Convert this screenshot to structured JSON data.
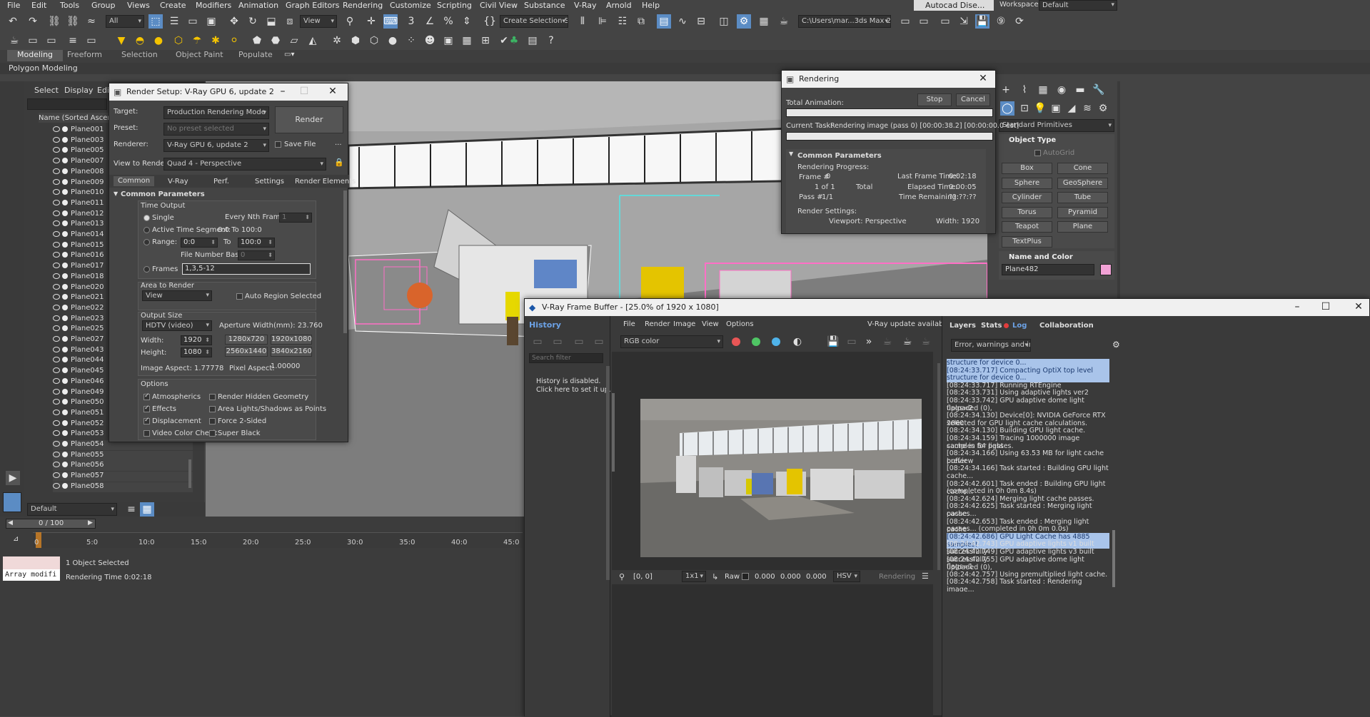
{
  "menubar": {
    "items": [
      "File",
      "Edit",
      "Tools",
      "Group",
      "Views",
      "Create",
      "Modifiers",
      "Animation",
      "Graph Editors",
      "Rendering",
      "Customize",
      "Scripting",
      "Civil View",
      "Substance",
      "V-Ray",
      "Arnold",
      "Help"
    ],
    "user": "Autocad Dise...",
    "workspaces_label": "Workspaces:",
    "workspace_value": "Default"
  },
  "toolbar": {
    "filter_value": "All",
    "view_value": "View",
    "selection_set": "Create Selection Se",
    "project_path": "C:\\Users\\mar...3ds Max 2024"
  },
  "ribbon": {
    "tabs": [
      "Modeling",
      "Freeform",
      "Selection",
      "Object Paint",
      "Populate"
    ],
    "sub": "Polygon Modeling"
  },
  "scene_explorer": {
    "tabs": [
      "Select",
      "Display",
      "Edi"
    ],
    "column": "Name (Sorted Ascending",
    "items": [
      "Plane001",
      "Plane003",
      "Plane005",
      "Plane007",
      "Plane008",
      "Plane009",
      "Plane010",
      "Plane011",
      "Plane012",
      "Plane013",
      "Plane014",
      "Plane015",
      "Plane016",
      "Plane017",
      "Plane018",
      "Plane020",
      "Plane021",
      "Plane022",
      "Plane023",
      "Plane025",
      "Plane027",
      "Plane043",
      "Plane044",
      "Plane045",
      "Plane046",
      "Plane049",
      "Plane050",
      "Plane051",
      "Plane052",
      "Plane053",
      "Plane054",
      "Plane055",
      "Plane056",
      "Plane057",
      "Plane058"
    ],
    "layer": "Default"
  },
  "render_setup": {
    "title": "Render Setup: V-Ray GPU 6, update 2",
    "target_label": "Target:",
    "target_value": "Production Rendering Mode",
    "preset_label": "Preset:",
    "preset_value": "No preset selected",
    "renderer_label": "Renderer:",
    "renderer_value": "V-Ray GPU 6, update 2",
    "save_file": "Save File",
    "view_label": "View to Render:",
    "view_value": "Quad 4 - Perspective",
    "render_button": "Render",
    "ellipsis": "...",
    "tabs": [
      "Common",
      "V-Ray",
      "Perf.",
      "Settings",
      "Render Elements"
    ],
    "rollout": "Common Parameters",
    "time_output": "Time Output",
    "single": "Single",
    "every_nth": "Every Nth Frame:",
    "every_nth_value": "1",
    "active_segment": "Active Time Segment:",
    "active_segment_value": "0:0 To 100:0",
    "range": "Range:",
    "range_from": "0:0",
    "to": "To",
    "range_to": "100:0",
    "file_number_base": "File Number Base:",
    "file_number_value": "0",
    "frames": "Frames",
    "frames_value": "1,3,5-12",
    "area_to_render": "Area to Render",
    "area_value": "View",
    "auto_region": "Auto Region Selected",
    "output_size": "Output Size",
    "output_value": "HDTV (video)",
    "aperture": "Aperture Width(mm): 23.760",
    "width_label": "Width:",
    "width_value": "1920",
    "height_label": "Height:",
    "height_value": "1080",
    "presets": [
      "1280x720",
      "1920x1080",
      "2560x1440",
      "3840x2160"
    ],
    "image_aspect": "Image Aspect: 1.77778",
    "pixel_aspect_label": "Pixel Aspect:",
    "pixel_aspect_value": "1.00000",
    "options": "Options",
    "opt_left": [
      "Atmospherics",
      "Effects",
      "Displacement",
      "Video Color Check"
    ],
    "opt_right": [
      "Render Hidden Geometry",
      "Area Lights/Shadows as Points",
      "Force 2-Sided",
      "Super Black"
    ]
  },
  "rendering_dialog": {
    "title": "Rendering",
    "total_animation": "Total Animation:",
    "stop": "Stop",
    "cancel": "Cancel",
    "current_task": "Current Task:",
    "current_task_value": "Rendering image (pass 0) [00:00:38.2] [00:00:00.0 est]",
    "rollout": "Common Parameters",
    "progress": "Rendering Progress:",
    "frame_label": "Frame #",
    "frame_value": "0",
    "of": "1 of 1",
    "total": "Total",
    "pass_label": "Pass #",
    "pass_value": "1/1",
    "last_frame": "Last Frame Time:",
    "last_frame_value": "0:02:18",
    "elapsed": "Elapsed Time:",
    "elapsed_value": "0:00:05",
    "remaining": "Time Remaining:",
    "remaining_value": "??:??:??",
    "settings": "Render Settings:",
    "viewport": "Viewport: Perspective",
    "width": "Width: 1920"
  },
  "command_panel": {
    "category": "Standard Primitives",
    "object_type": "Object Type",
    "autogrid": "AutoGrid",
    "buttons": [
      "Box",
      "Cone",
      "Sphere",
      "GeoSphere",
      "Cylinder",
      "Tube",
      "Torus",
      "Pyramid",
      "Teapot",
      "Plane",
      "TextPlus"
    ],
    "name_color": "Name and Color",
    "object_name": "Plane482",
    "object_color": "#f2a2d6"
  },
  "vfb": {
    "title": "V-Ray Frame Buffer - [25.0% of 1920 x 1080]",
    "history_tab": "History",
    "menu": [
      "File",
      "Render",
      "Image",
      "View",
      "Options"
    ],
    "update": "V-Ray update available!",
    "channel": "RGB color",
    "search_placeholder": "Search filter",
    "history_msg1": "History is disabled.",
    "history_msg2": "Click here to set it up.",
    "right_tabs": [
      "Layers",
      "Stats",
      "Log",
      "Collaboration"
    ],
    "log_filter": "Error, warnings and info",
    "coords": "[0, 0]",
    "zoom": "1x1",
    "raw": "Raw",
    "values": [
      "0.000",
      "0.000",
      "0.000"
    ],
    "hsv": "HSV",
    "status": "Rendering",
    "log": [
      {
        "t": "structure for device 0...",
        "hl": true
      },
      {
        "t": "[08:24:33.717] Compacting OptiX top level acceleration",
        "hl": true
      },
      {
        "t": "structure for device 0...",
        "hl": true
      },
      {
        "t": "[08:24:33.717] Running RTEngine",
        "hl": false
      },
      {
        "t": "[08:24:33.731] Using adaptive lights ver2",
        "hl": false
      },
      {
        "t": "[08:24:33.742] GPU adaptive dome light uploaded (0),",
        "hl": false
      },
      {
        "t": "flags=2",
        "hl": false
      },
      {
        "t": "[08:24:34.130] Device[0]: NVIDIA GeForce RTX 2060",
        "hl": false
      },
      {
        "t": "selected for GPU light cache calculations.",
        "hl": false
      },
      {
        "t": "[08:24:34.130] Building GPU light cache.",
        "hl": false
      },
      {
        "t": "[08:24:34.159] Tracing 1000000 image samples for light",
        "hl": false
      },
      {
        "t": "cache in 64 passes.",
        "hl": false
      },
      {
        "t": "[08:24:34.166] Using 63.53 MB for light cache preview",
        "hl": false
      },
      {
        "t": "buffer",
        "hl": false
      },
      {
        "t": "[08:24:34.166]   Task started : Building GPU light",
        "hl": false
      },
      {
        "t": "cache...",
        "hl": false
      },
      {
        "t": "[08:24:42.601]   Task ended : Building GPU light cache...",
        "hl": false
      },
      {
        "t": "(completed in  0h  0m  8.4s)",
        "hl": false
      },
      {
        "t": "[08:24:42.624] Merging light cache passes.",
        "hl": false
      },
      {
        "t": "[08:24:42.625]   Task started : Merging light cache",
        "hl": false
      },
      {
        "t": "passes...",
        "hl": false
      },
      {
        "t": "[08:24:42.653]   Task ended : Merging light cache",
        "hl": false
      },
      {
        "t": "passes... (completed in  0h  0m  0.0s)",
        "hl": false
      },
      {
        "t": "[08:24:42.686] GPU Light Cache has 4885 samples!",
        "hl": true
      },
      {
        "t": "[08:24:42.743] GPU adaptive lights v1 built successfully",
        "hl": false
      },
      {
        "t": "[08:24:42.749] GPU adaptive lights v3 built successfully",
        "hl": false
      },
      {
        "t": "[08:24:42.755] GPU adaptive dome light uploaded (0),",
        "hl": false
      },
      {
        "t": "flags=1",
        "hl": false
      },
      {
        "t": "[08:24:42.757] Using premultiplied light cache.",
        "hl": false
      },
      {
        "t": "[08:24:42.758]   Task started : Rendering image...",
        "hl": false
      }
    ]
  },
  "timeline": {
    "frame": "0 / 100",
    "ticks": [
      "0",
      "5:0",
      "10:0",
      "15:0",
      "20:0",
      "25:0",
      "30:0",
      "35:0",
      "40:0",
      "45:0"
    ]
  },
  "status": {
    "script": "Array modifi",
    "selected": "1 Object Selected",
    "render_time": "Rendering Time  0:02:18"
  },
  "colors": {
    "accent": "#5b8cc4",
    "selection": "#f08bd0",
    "highlight": "#a9c4ea"
  }
}
